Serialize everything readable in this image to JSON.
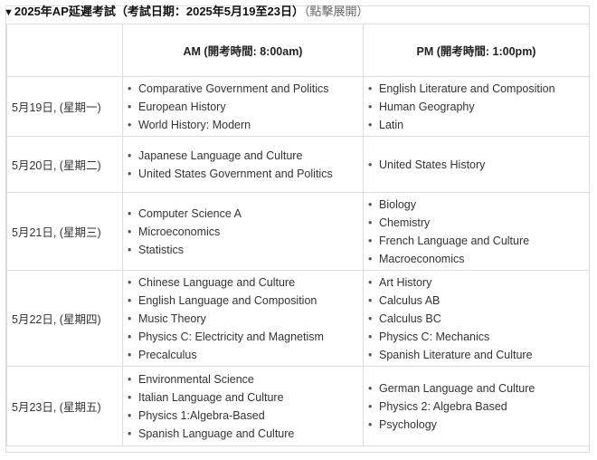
{
  "summary": {
    "arrow": "▼",
    "title": "2025年AP延遲考試（考試日期：2025年5月19至23日）",
    "hint": "（點擊展開）"
  },
  "table": {
    "headers": [
      "",
      "AM (開考時間: 8:00am)",
      "PM (開考時間: 1:00pm)"
    ],
    "rows": [
      {
        "date": "5月19日, (星期一)",
        "am": [
          "Comparative Government and Politics",
          "European History",
          "World History: Modern"
        ],
        "pm": [
          "English Literature and Composition",
          "Human Geography",
          "Latin"
        ]
      },
      {
        "date": "5月20日, (星期二)",
        "am": [
          "Japanese Language and Culture",
          "United States Government and Politics"
        ],
        "pm": [
          "United States History"
        ]
      },
      {
        "date": "5月21日, (星期三)",
        "am": [
          "Computer Science A",
          "Microeconomics",
          "Statistics"
        ],
        "pm": [
          "Biology",
          "Chemistry",
          "French Language and Culture",
          "Macroeconomics"
        ]
      },
      {
        "date": "5月22日, (星期四)",
        "am": [
          "Chinese Language and Culture",
          "English Language and Composition",
          "Music Theory",
          "Physics C: Electricity and Magnetism",
          "Precalculus"
        ],
        "pm": [
          "Art History",
          "Calculus AB",
          "Calculus BC",
          "Physics C: Mechanics",
          "Spanish Literature and Culture"
        ]
      },
      {
        "date": "5月23日, (星期五)",
        "am": [
          "Environmental Science",
          "Italian Language and Culture",
          "Physics 1:Algebra-Based",
          "Spanish Language and Culture"
        ],
        "pm": [
          "German Language and Culture",
          "Physics 2: Algebra Based",
          "Psychology"
        ]
      }
    ]
  }
}
